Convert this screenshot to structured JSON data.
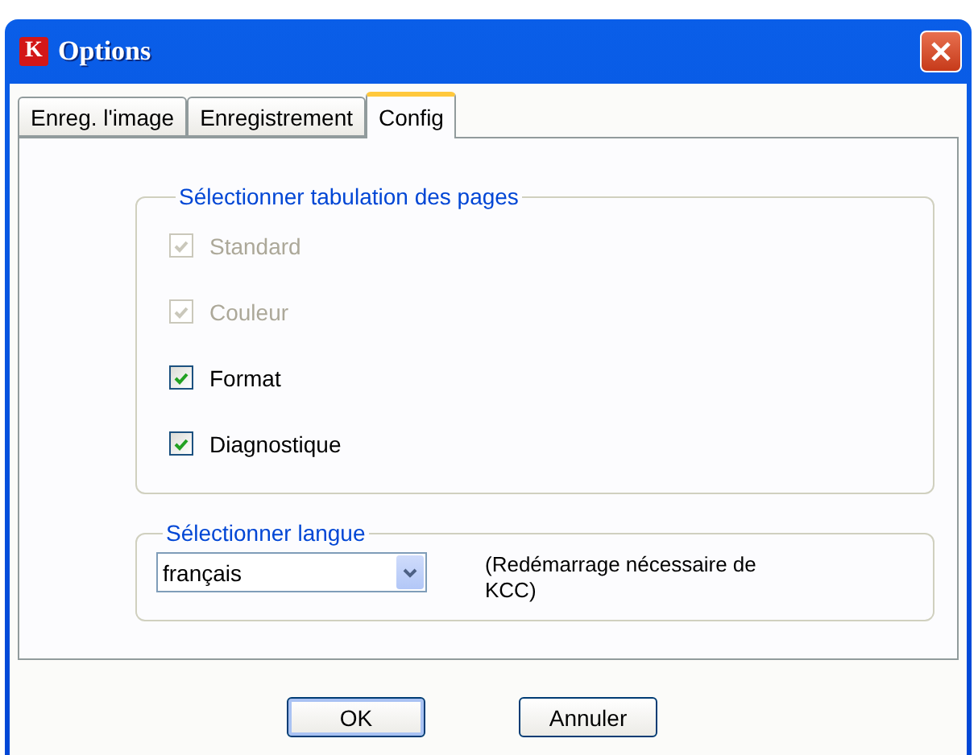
{
  "window": {
    "title": "Options",
    "app_letter": "K"
  },
  "tabs": [
    {
      "label": "Enreg. l'image",
      "selected": false
    },
    {
      "label": "Enregistrement",
      "selected": false
    },
    {
      "label": "Config",
      "selected": true
    }
  ],
  "pages_group": {
    "title": "Sélectionner tabulation des pages",
    "options": [
      {
        "label": "Standard",
        "checked": true,
        "disabled": true
      },
      {
        "label": "Couleur",
        "checked": true,
        "disabled": true
      },
      {
        "label": "Format",
        "checked": true,
        "disabled": false
      },
      {
        "label": "Diagnostique",
        "checked": true,
        "disabled": false
      }
    ]
  },
  "language_group": {
    "title": "Sélectionner langue",
    "value": "français",
    "note": "(Redémarrage nécessaire de KCC)"
  },
  "buttons": [
    {
      "label": "OK",
      "default": true
    },
    {
      "label": "Annuler",
      "default": false
    }
  ]
}
